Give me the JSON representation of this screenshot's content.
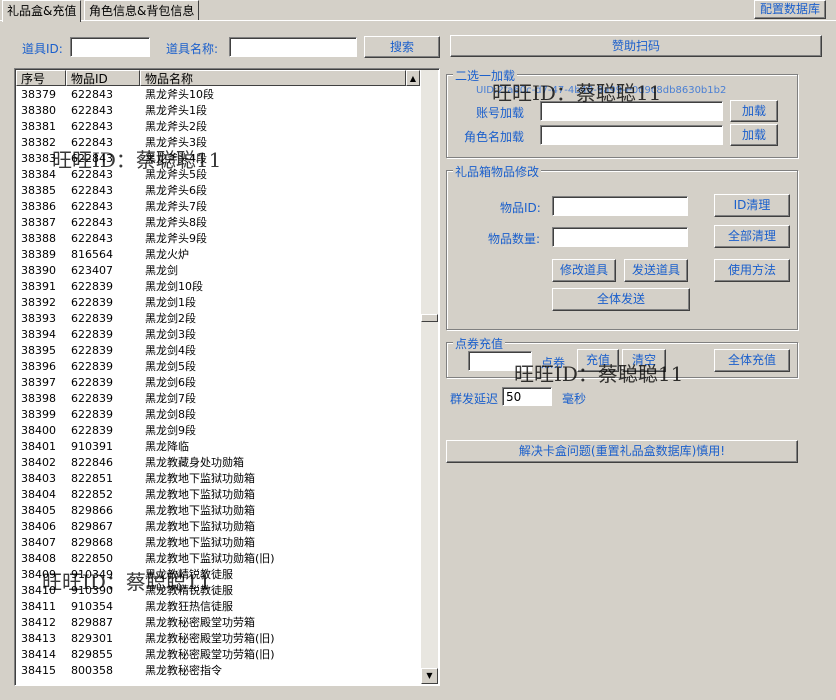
{
  "tabs": [
    {
      "label": "礼品盒&充值",
      "active": true
    },
    {
      "label": "角色信息&背包信息",
      "active": false
    }
  ],
  "config_db_button": "配置数据库",
  "search": {
    "item_id_label": "道具ID:",
    "item_id_value": "",
    "item_name_label": "道具名称:",
    "item_name_value": "",
    "search_button": "搜索"
  },
  "sponsor_button": "赞助扫码",
  "list": {
    "columns": [
      "序号",
      "物品ID",
      "物品名称"
    ],
    "rows": [
      [
        "38379",
        "622843",
        "黑龙斧头10段"
      ],
      [
        "38380",
        "622843",
        "黑龙斧头1段"
      ],
      [
        "38381",
        "622843",
        "黑龙斧头2段"
      ],
      [
        "38382",
        "622843",
        "黑龙斧头3段"
      ],
      [
        "38383",
        "622843",
        "黑龙斧头4段"
      ],
      [
        "38384",
        "622843",
        "黑龙斧头5段"
      ],
      [
        "38385",
        "622843",
        "黑龙斧头6段"
      ],
      [
        "38386",
        "622843",
        "黑龙斧头7段"
      ],
      [
        "38387",
        "622843",
        "黑龙斧头8段"
      ],
      [
        "38388",
        "622843",
        "黑龙斧头9段"
      ],
      [
        "38389",
        "816564",
        "黑龙火炉"
      ],
      [
        "38390",
        "623407",
        "黑龙剑"
      ],
      [
        "38391",
        "622839",
        "黑龙剑10段"
      ],
      [
        "38392",
        "622839",
        "黑龙剑1段"
      ],
      [
        "38393",
        "622839",
        "黑龙剑2段"
      ],
      [
        "38394",
        "622839",
        "黑龙剑3段"
      ],
      [
        "38395",
        "622839",
        "黑龙剑4段"
      ],
      [
        "38396",
        "622839",
        "黑龙剑5段"
      ],
      [
        "38397",
        "622839",
        "黑龙剑6段"
      ],
      [
        "38398",
        "622839",
        "黑龙剑7段"
      ],
      [
        "38399",
        "622839",
        "黑龙剑8段"
      ],
      [
        "38400",
        "622839",
        "黑龙剑9段"
      ],
      [
        "38401",
        "910391",
        "黑龙降临"
      ],
      [
        "38402",
        "822846",
        "黑龙教藏身处功勋箱"
      ],
      [
        "38403",
        "822851",
        "黑龙教地下监狱功勋箱"
      ],
      [
        "38404",
        "822852",
        "黑龙教地下监狱功勋箱"
      ],
      [
        "38405",
        "829866",
        "黑龙教地下监狱功勋箱"
      ],
      [
        "38406",
        "829867",
        "黑龙教地下监狱功勋箱"
      ],
      [
        "38407",
        "829868",
        "黑龙教地下监狱功勋箱"
      ],
      [
        "38408",
        "822850",
        "黑龙教地下监狱功勋箱(旧)"
      ],
      [
        "38409",
        "910349",
        "黑龙教精锐教徒服"
      ],
      [
        "38410",
        "910390",
        "黑龙教精锐教徒服"
      ],
      [
        "38411",
        "910354",
        "黑龙教狂热信徒服"
      ],
      [
        "38412",
        "829887",
        "黑龙教秘密殿堂功劳箱"
      ],
      [
        "38413",
        "829301",
        "黑龙教秘密殿堂功劳箱(旧)"
      ],
      [
        "38414",
        "829855",
        "黑龙教秘密殿堂功劳箱(旧)"
      ],
      [
        "38415",
        "800358",
        "黑龙教秘密指令"
      ]
    ]
  },
  "group_select": {
    "title": "二选一加载",
    "uid_text": "UID:2fa60c-d7-47-4b48-9a99-e0d9c8db8630b1b2",
    "account_label": "账号加载",
    "account_value": "",
    "account_button": "加载",
    "role_label": "角色名加载",
    "role_value": "",
    "role_button": "加载"
  },
  "gift_box": {
    "title": "礼品箱物品修改",
    "item_id_label": "物品ID:",
    "item_id_value": "",
    "id_clear_button": "ID清理",
    "item_count_label": "物品数量:",
    "item_count_value": "",
    "clear_all_button": "全部清理",
    "modify_button": "修改道具",
    "send_button": "发送道具",
    "usage_button": "使用方法",
    "send_all_button": "全体发送"
  },
  "points": {
    "title": "点券充值",
    "amount_value": "",
    "unit_label": "点券",
    "charge_button": "充值",
    "clear_button": "清空",
    "charge_all_button": "全体充值"
  },
  "delay": {
    "label": "群发延迟",
    "value": "50",
    "unit": "毫秒"
  },
  "reset_button": "解决卡盒问题(重置礼品盒数据库)慎用!",
  "watermark": "旺旺ID：蔡聪聪11"
}
